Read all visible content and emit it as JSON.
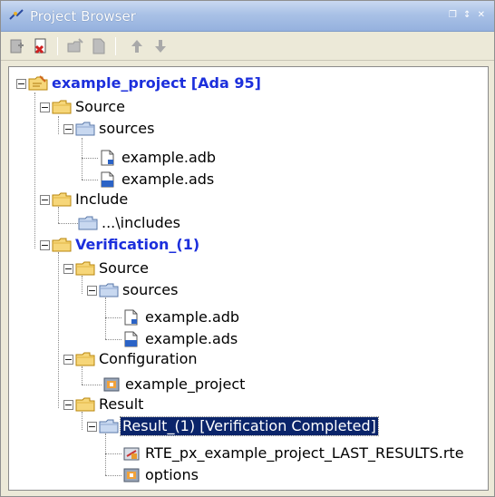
{
  "window": {
    "title": "Project Browser",
    "controls": "【↕×"
  },
  "toolbar": {
    "buttons": [
      "add-icon",
      "remove-icon",
      "new-folder-icon",
      "new-file-icon",
      "move-up-icon",
      "move-down-icon"
    ]
  },
  "tree": {
    "root": "example_project [Ada 95]",
    "source": "Source",
    "sources": "sources",
    "file_adb": "example.adb",
    "file_ads": "example.ads",
    "include": "Include",
    "includes": "...\\includes",
    "verification": "Verification_(1)",
    "v_source": "Source",
    "v_sources": "sources",
    "v_file_adb": "example.adb",
    "v_file_ads": "example.ads",
    "configuration": "Configuration",
    "config_item": "example_project",
    "result": "Result",
    "result_item": "Result_(1) [Verification Completed]",
    "rte_file": "RTE_px_example_project_LAST_RESULTS.rte",
    "options": "options"
  },
  "colors": {
    "folder": "#f3cd5a",
    "selected_bg": "#0a246a",
    "bold_text": "#1c2fdc"
  }
}
